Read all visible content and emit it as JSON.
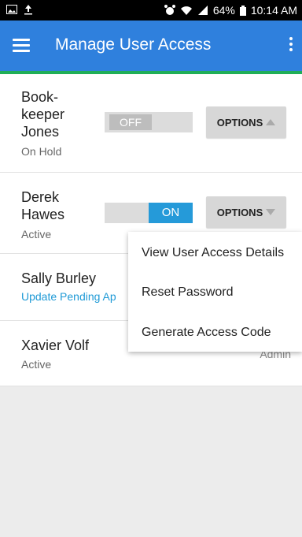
{
  "status_bar": {
    "left_icons": [
      "image-icon",
      "upload-icon"
    ],
    "battery": "64%",
    "time": "10:14 AM"
  },
  "app_bar": {
    "title": "Manage User Access"
  },
  "users": [
    {
      "name_lines": [
        "Book-",
        "keeper",
        "Jones"
      ],
      "status": "On Hold",
      "toggle": "OFF",
      "options_label": "OPTIONS"
    },
    {
      "name_lines": [
        "Derek",
        "Hawes"
      ],
      "status": "Active",
      "toggle": "ON",
      "options_label": "OPTIONS"
    },
    {
      "name_lines": [
        "Sally Burley"
      ],
      "status": "Update Pending Ap"
    },
    {
      "name_lines": [
        "Xavier Volf"
      ],
      "status": "Active",
      "role": "Admin"
    }
  ],
  "dropdown": {
    "items": [
      "View User Access Details",
      "Reset Password",
      "Generate Access Code"
    ]
  }
}
